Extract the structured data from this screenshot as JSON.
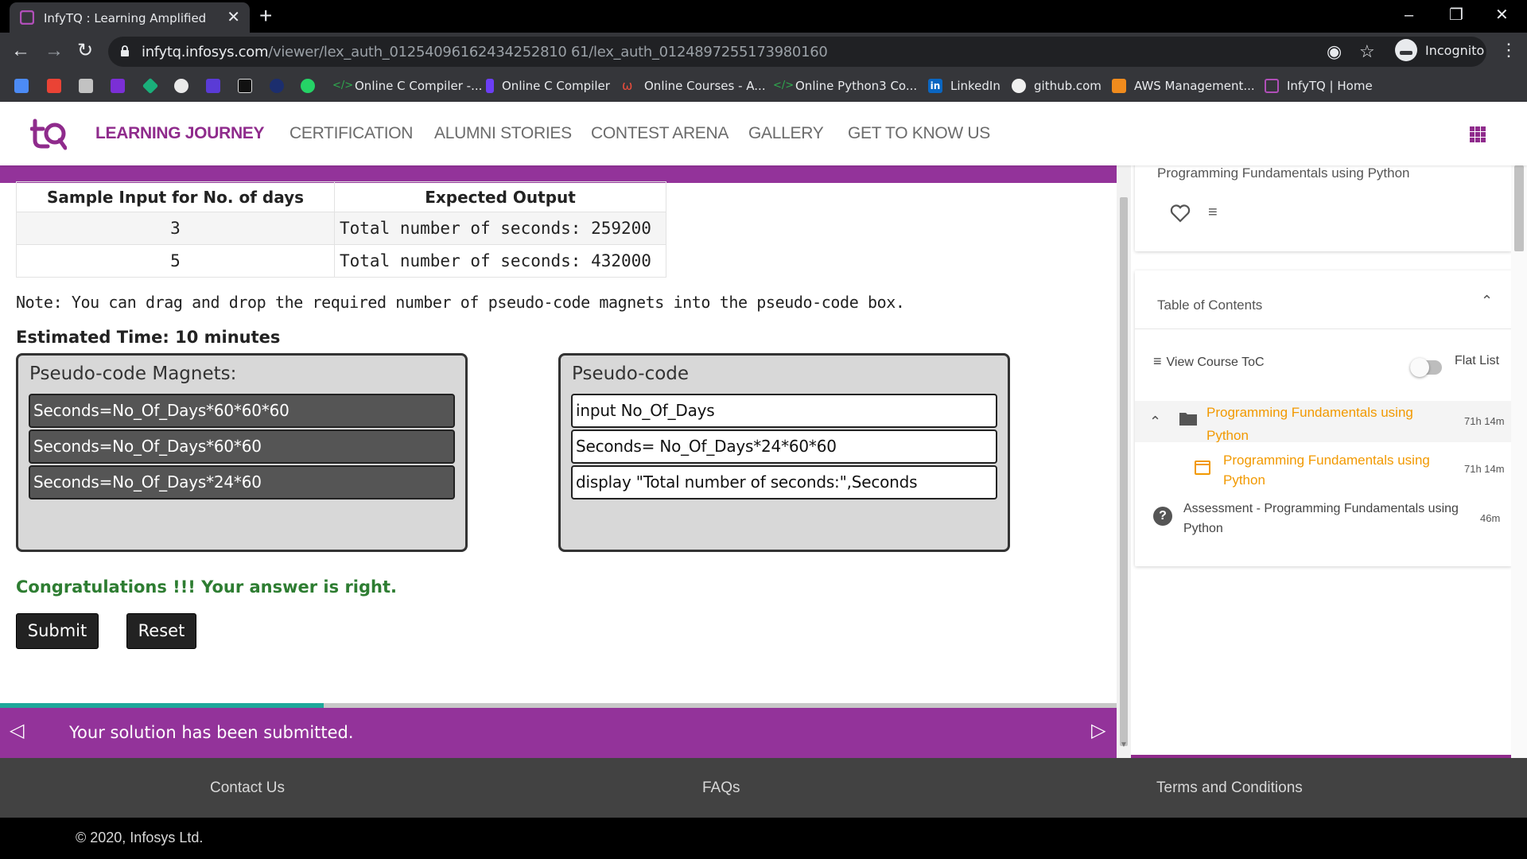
{
  "browser": {
    "tab_title": "InfyTQ : Learning Amplified",
    "url_host": "infytq.infosys.com",
    "url_path": "/viewer/lex_auth_01254096162434252810 61/lex_auth_0124897255173980160",
    "profile_label": "Incognito",
    "bookmarks": [
      "Online C Compiler -...",
      "Online C Compiler",
      "Online Courses - A...",
      "Online Python3 Co...",
      "LinkedIn",
      "github.com",
      "AWS Management...",
      "InfyTQ | Home"
    ]
  },
  "site_nav": {
    "items": [
      "LEARNING JOURNEY",
      "CERTIFICATION",
      "ALUMNI STORIES",
      "CONTEST ARENA",
      "GALLERY",
      "GET TO KNOW US"
    ],
    "active": "LEARNING JOURNEY"
  },
  "sample_table": {
    "headers": [
      "Sample Input for No. of days",
      "Expected Output"
    ],
    "rows": [
      [
        "3",
        "Total number of seconds: 259200"
      ],
      [
        "5",
        "Total number of seconds: 432000"
      ]
    ]
  },
  "note": "Note: You can drag and drop the required number of pseudo-code magnets into the pseudo-code box.",
  "estimated_time": "Estimated Time: 10 minutes",
  "magnets_box": {
    "title": "Pseudo-code Magnets:",
    "items": [
      "Seconds=No_Of_Days*60*60*60",
      "Seconds=No_Of_Days*60*60",
      "Seconds=No_Of_Days*24*60"
    ]
  },
  "code_box": {
    "title": "Pseudo-code",
    "lines": [
      "input No_Of_Days",
      "Seconds= No_Of_Days*24*60*60",
      "display \"Total number of seconds:\",Seconds"
    ]
  },
  "result_message": "Congratulations !!! Your answer is right.",
  "buttons": {
    "submit": "Submit",
    "reset": "Reset"
  },
  "status": {
    "message": "Your solution has been submitted.",
    "progress_fraction": 0.29
  },
  "sidebar": {
    "course_title": "Programming Fundamentals using Python",
    "toc_title": "Table of Contents",
    "view_toc": "View Course ToC",
    "flat_list": "Flat List",
    "items": [
      {
        "title": "Programming Fundamentals using Python",
        "time": "71h 14m"
      },
      {
        "title": "Programming Fundamentals using Python",
        "time": "71h 14m"
      },
      {
        "title": "Assessment - Programming Fundamentals using Python",
        "time": "46m"
      }
    ]
  },
  "footer": {
    "links": [
      "Contact Us",
      "FAQs",
      "Terms and Conditions"
    ],
    "copyright": "© 2020, Infosys Ltd."
  },
  "colors": {
    "brand_purple": "#93339a",
    "success_green": "#2e7d32",
    "progress_teal": "#1fa89a",
    "accent_orange": "#f29900"
  }
}
